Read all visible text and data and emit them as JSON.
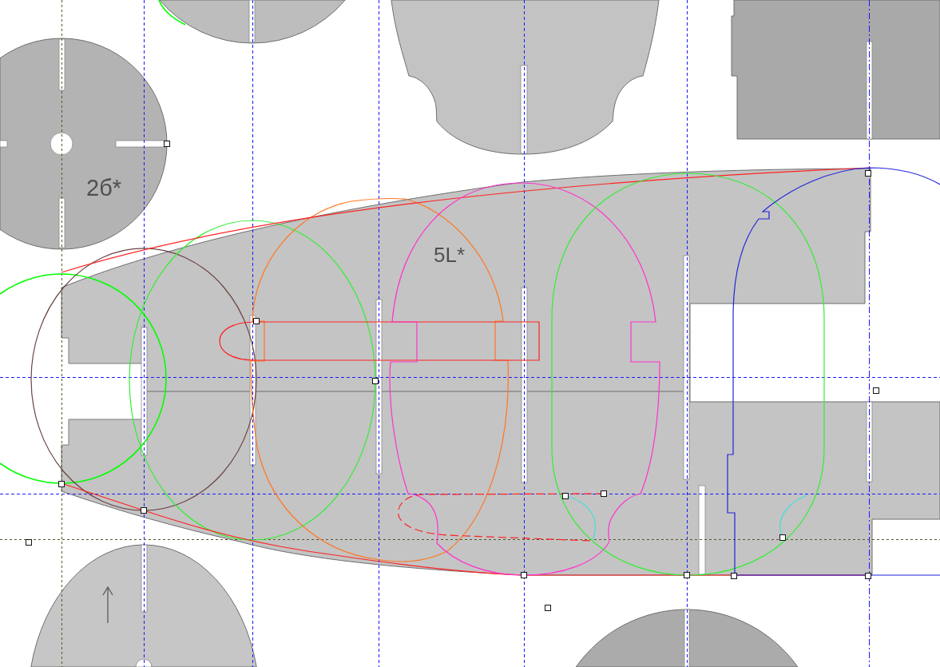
{
  "sheet": {
    "part_labels": [
      {
        "text": "2б*"
      },
      {
        "text": "5L*"
      }
    ]
  }
}
